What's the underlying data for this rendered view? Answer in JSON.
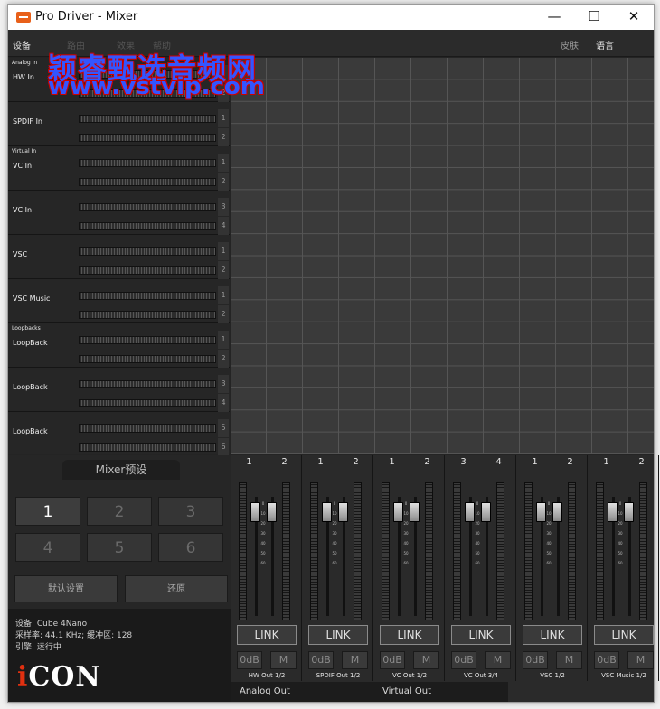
{
  "window": {
    "title": "Pro Driver - Mixer",
    "minimize": "—",
    "maximize": "☐",
    "close": "✕"
  },
  "menu": {
    "device": "设备",
    "item2": "路由",
    "item3": "效果",
    "item4": "帮助",
    "skin": "皮肤",
    "language": "语言"
  },
  "watermark": {
    "line1": "颖睿甄选音频网",
    "line2": "www.vstvip.com"
  },
  "groups": {
    "analog": "Analog In",
    "virtual": "Virtual In",
    "loopbacks": "Loopbacks"
  },
  "inputs": [
    {
      "name": "HW In",
      "ch": [
        "1",
        "2"
      ]
    },
    {
      "name": "SPDIF In",
      "ch": [
        "1",
        "2"
      ]
    },
    {
      "name": "VC In",
      "ch": [
        "1",
        "2"
      ]
    },
    {
      "name": "VC In",
      "ch": [
        "3",
        "4"
      ]
    },
    {
      "name": "VSC",
      "ch": [
        "1",
        "2"
      ]
    },
    {
      "name": "VSC Music",
      "ch": [
        "1",
        "2"
      ]
    },
    {
      "name": "LoopBack",
      "ch": [
        "1",
        "2"
      ]
    },
    {
      "name": "LoopBack",
      "ch": [
        "3",
        "4"
      ]
    },
    {
      "name": "LoopBack",
      "ch": [
        "5",
        "6"
      ]
    }
  ],
  "presets": {
    "title": "Mixer预设",
    "buttons": [
      "1",
      "2",
      "3",
      "4",
      "5",
      "6"
    ],
    "active": "1",
    "default": "默认设置",
    "restore": "还原"
  },
  "device": {
    "name": "设备: Cube 4Nano",
    "rate": "采样率: 44.1 KHz; 缓冲区: 128",
    "engine": "引擎: 运行中"
  },
  "logo": {
    "i": "i",
    "rest": "CON"
  },
  "strips": [
    {
      "ch": [
        "1",
        "2"
      ],
      "link": "LINK",
      "db": "0dB",
      "mute": "M",
      "name": "HW Out 1/2"
    },
    {
      "ch": [
        "1",
        "2"
      ],
      "link": "LINK",
      "db": "0dB",
      "mute": "M",
      "name": "SPDIF Out 1/2"
    },
    {
      "ch": [
        "1",
        "2"
      ],
      "link": "LINK",
      "db": "0dB",
      "mute": "M",
      "name": "VC Out 1/2"
    },
    {
      "ch": [
        "3",
        "4"
      ],
      "link": "LINK",
      "db": "0dB",
      "mute": "M",
      "name": "VC Out 3/4"
    },
    {
      "ch": [
        "1",
        "2"
      ],
      "link": "LINK",
      "db": "0dB",
      "mute": "M",
      "name": "VSC 1/2"
    },
    {
      "ch": [
        "1",
        "2"
      ],
      "link": "LINK",
      "db": "0dB",
      "mute": "M",
      "name": "VSC Music 1/2"
    }
  ],
  "scale": [
    "0",
    "10",
    "20",
    "30",
    "40",
    "50",
    "60"
  ],
  "outputs": {
    "analog": "Analog Out",
    "virtual": "Virtual Out"
  }
}
